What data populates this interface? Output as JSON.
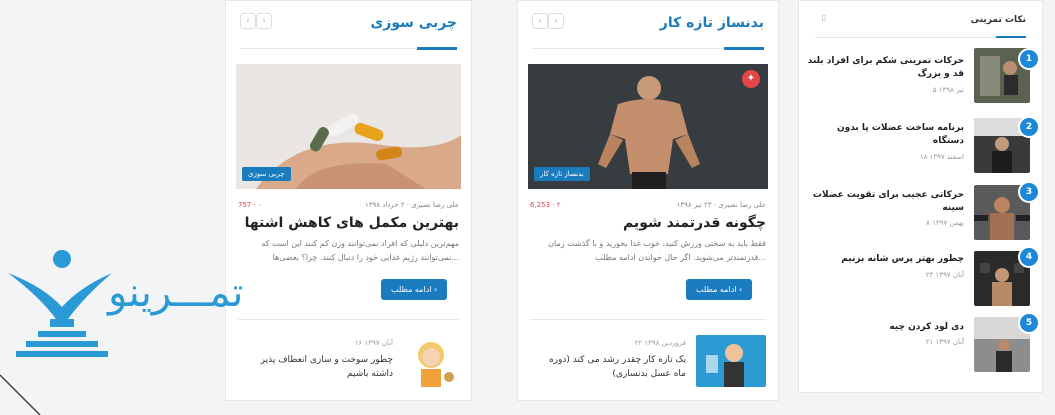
{
  "sidebar": {
    "title": "نکات تمرینی",
    "items": [
      {
        "num": "1",
        "title": "حرکات تمرینی شکم برای افراد بلند قد و بزرگ",
        "date": "۵ تیر ۱۳۹۸"
      },
      {
        "num": "2",
        "title": "برنامه ساخت عضلات پا بدون دستگاه",
        "date": "۱۸ اسفند ۱۳۹۷"
      },
      {
        "num": "3",
        "title": "حرکاتی عجیب برای تقویت عضلات سینه",
        "date": "۸ بهمن ۱۳۹۷"
      },
      {
        "num": "4",
        "title": "چطور بهتر پرس شانه بزنیم",
        "date": "۲۴ آبان ۱۳۹۷"
      },
      {
        "num": "5",
        "title": "دی لود کردن چیه",
        "date": "۲۱ آبان ۱۳۹۷"
      }
    ]
  },
  "col_middle": {
    "title": "بدنساز تازه کار",
    "category": "بدنساز تازه کار",
    "meta": "علی رضا نصیری · ۲۳ تیر ۱۳۹۸",
    "stats": "6,253 · ۲",
    "post_title": "چگونه قدرتمند شویم",
    "excerpt": "فقط باید به سختی ورزش کنید، خوب غذا بخورید و با گذشت زمان قدرتمندتر می‌شوید. اگر حال خواندن ادامه مطلب...",
    "more": "ادامه مطلب",
    "small": {
      "date": "۲۲ فروردین ۱۳۹۸",
      "title": "یک تازه کار چقدر رشد می کند (دوره ماه عسل بدنسازی)"
    }
  },
  "col_left": {
    "title": "چربی سوزی",
    "category": "چربی سوزی",
    "meta": "علی رضا نصیری · ۲ خرداد ۱۳۹۸",
    "stats": "757 · ۰",
    "post_title": "بهترین مکمل های کاهش اشتها",
    "excerpt": "مهم‌ترین دلیلی که افراد نمی‌توانند وزن کم کنند این است که نمی‌توانند رژیم غذایی خود را دنبال کنند. چرا؟ بعضی‌ها...",
    "more": "ادامه مطلب",
    "small": {
      "date": "۱۶ آبان ۱۳۹۷",
      "title": "چطور سوخت و سازی انعطاف پذیر داشته باشیم"
    }
  },
  "logo": {
    "text": "تمـــرینو"
  },
  "colors": {
    "accent": "#1a7bbf",
    "badge": "#1e88d8",
    "hot": "#e24646"
  }
}
